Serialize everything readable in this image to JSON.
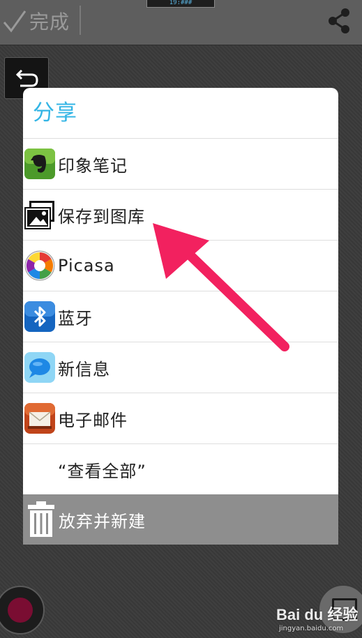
{
  "topbar": {
    "done_label": "完成",
    "status_text": "19:###"
  },
  "dialog": {
    "title": "分享",
    "items": [
      {
        "label": "印象笔记",
        "icon": "evernote-icon"
      },
      {
        "label": "保存到图库",
        "icon": "gallery-icon"
      },
      {
        "label": "Picasa",
        "icon": "picasa-icon"
      },
      {
        "label": "蓝牙",
        "icon": "bluetooth-icon"
      },
      {
        "label": "新信息",
        "icon": "message-icon"
      },
      {
        "label": "电子邮件",
        "icon": "email-icon"
      }
    ],
    "view_all_label": "“查看全部”",
    "discard_label": "放弃并新建"
  },
  "watermark": {
    "brand": "Bai du 经验",
    "url": "jingyan.baidu.com"
  },
  "colors": {
    "accent": "#33b5e5",
    "annotation_arrow": "#f2215f",
    "discard_bar": "#8e8e8e"
  }
}
